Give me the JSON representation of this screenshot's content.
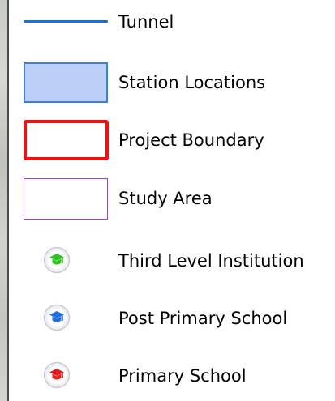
{
  "legend": {
    "items": [
      {
        "label": "Tunnel",
        "symbol": "line",
        "color": "#1a6ee6"
      },
      {
        "label": "Station Locations",
        "symbol": "filled-box",
        "fill": "#bcd0f7",
        "stroke": "#3a7fd8"
      },
      {
        "label": "Project Boundary",
        "symbol": "outline-box",
        "stroke": "#ee1111"
      },
      {
        "label": "Study Area",
        "symbol": "outline-box",
        "stroke": "#a23fc9"
      },
      {
        "label": "Third Level Institution",
        "symbol": "graduation-cap-icon",
        "color": "#2ec41d"
      },
      {
        "label": "Post Primary School",
        "symbol": "graduation-cap-icon",
        "color": "#1f6fe0"
      },
      {
        "label": "Primary School",
        "symbol": "graduation-cap-icon",
        "color": "#e11b1b"
      }
    ]
  }
}
